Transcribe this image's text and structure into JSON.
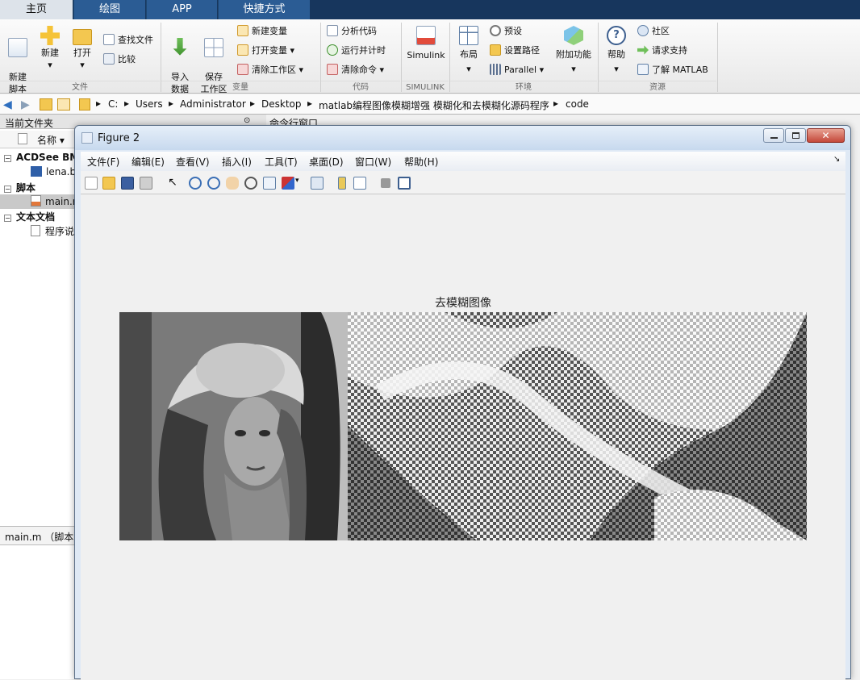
{
  "tabs": [
    "主页",
    "绘图",
    "APP",
    "快捷方式"
  ],
  "ribbon": {
    "new_script": "新建\n脚本",
    "new": "新建",
    "open": "打开",
    "find_files": "查找文件",
    "compare": "比较",
    "import_data": "导入\n数据",
    "save_workspace": "保存\n工作区",
    "new_variable": "新建变量",
    "open_variable": "打开变量",
    "clear_workspace": "清除工作区",
    "analyze_code": "分析代码",
    "run_and_time": "运行并计时",
    "clear_commands": "清除命令",
    "simulink": "Simulink",
    "layout": "布局",
    "preferences": "预设",
    "set_path": "设置路径",
    "parallel": "Parallel",
    "addons": "附加功能",
    "help": "帮助",
    "community": "社区",
    "request_support": "请求支持",
    "learn_matlab": "了解 MATLAB",
    "groups": [
      "文件",
      "变量",
      "代码",
      "SIMULINK",
      "环境",
      "资源"
    ]
  },
  "path": [
    "C:",
    "Users",
    "Administrator",
    "Desktop",
    "matlab编程图像模糊增强 模糊化和去模糊化源码程序",
    "code"
  ],
  "left": {
    "header": "当前文件夹",
    "col_name": "名称",
    "cmd_header": "命令行窗口",
    "group_acdsee": "ACDSee BM",
    "file_lena": "lena.b",
    "group_script": "脚本",
    "file_main": "main.r",
    "group_text": "文本文档",
    "file_readme": "程序说",
    "details": "main.m （脚本）"
  },
  "figure": {
    "title": "Figure 2",
    "menu": [
      "文件(F)",
      "编辑(E)",
      "查看(V)",
      "插入(I)",
      "工具(T)",
      "桌面(D)",
      "窗口(W)",
      "帮助(H)"
    ],
    "plot_title": "去模糊图像"
  }
}
